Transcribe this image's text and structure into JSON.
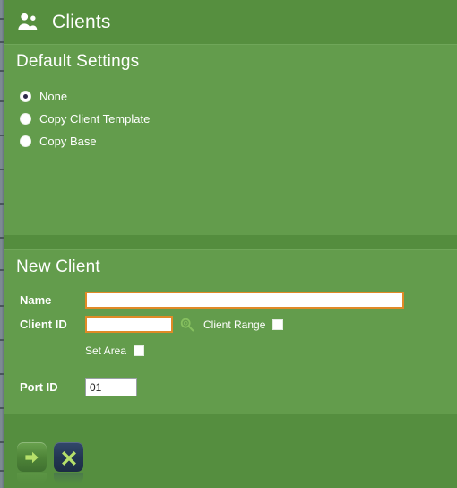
{
  "window": {
    "title": "Clients",
    "title_icon": "clients-people-icon"
  },
  "colors": {
    "header_green": "#568f3f",
    "panel_green": "#639c4c",
    "footer_green": "#558e3f",
    "input_border_orange": "#e08a27",
    "radio_dot_navy": "#2d2a4a",
    "cancel_button_navy": "#233753",
    "text_white": "#ffffff"
  },
  "default_settings": {
    "title": "Default Settings",
    "options": [
      {
        "label": "None",
        "selected": true
      },
      {
        "label": "Copy Client Template",
        "selected": false
      },
      {
        "label": "Copy Base",
        "selected": false
      }
    ]
  },
  "new_client": {
    "title": "New Client",
    "fields": {
      "name": {
        "label": "Name",
        "value": "",
        "placeholder": ""
      },
      "client_id": {
        "label": "Client ID",
        "value": "",
        "placeholder": ""
      },
      "port_id": {
        "label": "Port ID",
        "value": "01",
        "placeholder": ""
      }
    },
    "client_range": {
      "label": "Client Range",
      "checked": false
    },
    "set_area": {
      "label": "Set Area",
      "checked": false
    },
    "search_icon": "search-icon"
  },
  "footer": {
    "ok_button": {
      "icon": "arrow-right-icon",
      "label": ""
    },
    "cancel_button": {
      "icon": "close-x-icon",
      "label": ""
    }
  }
}
